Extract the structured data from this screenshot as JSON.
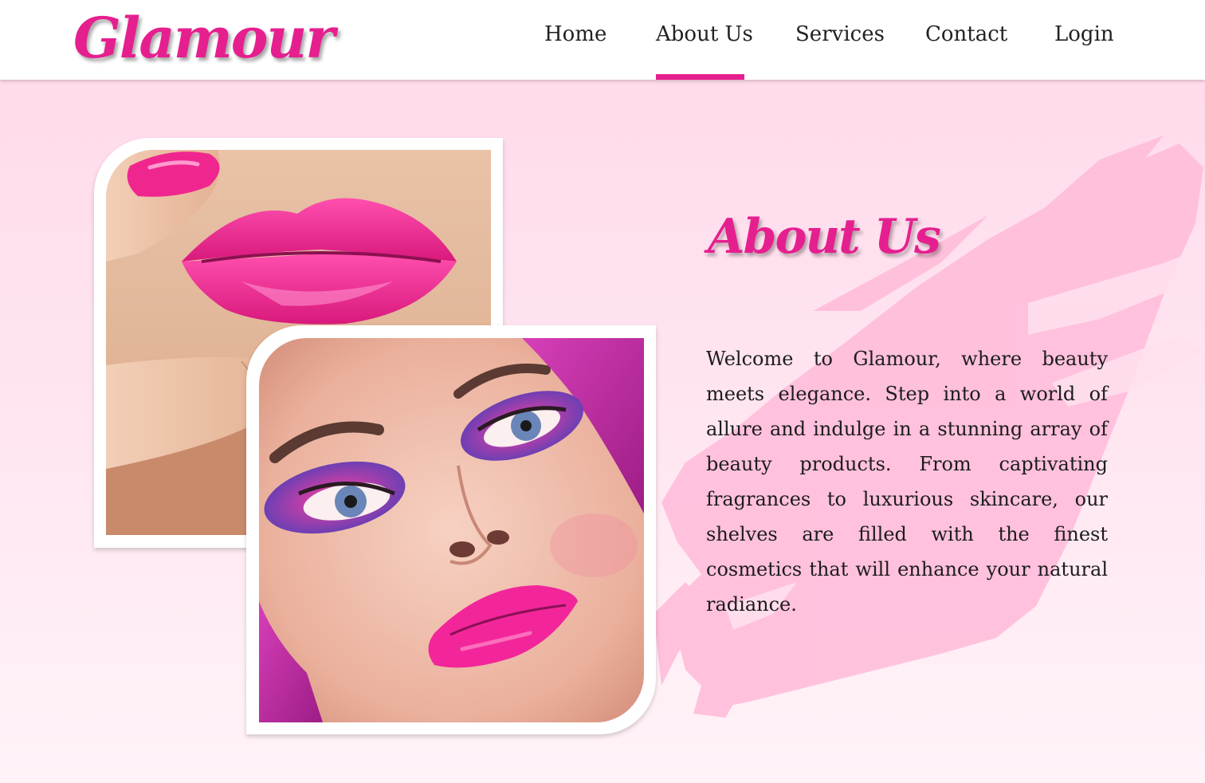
{
  "header": {
    "logo": "Glamour",
    "nav": [
      {
        "label": "Home",
        "active": false
      },
      {
        "label": "About Us",
        "active": true
      },
      {
        "label": "Services",
        "active": false
      },
      {
        "label": "Contact",
        "active": false
      },
      {
        "label": "Login",
        "active": false
      }
    ]
  },
  "about": {
    "title": "About Us",
    "body": "Welcome to Glamour, where beauty meets elegance. Step into a world of allure and indulge in a stunning array of beauty products. From captivating fragrances to luxurious skincare, our shelves are filled with the finest cosmetics that will enhance your natural radiance."
  },
  "images": {
    "lips_photo": "lips-closeup",
    "face_photo": "makeup-model"
  },
  "colors": {
    "accent": "#e61f8f",
    "background": "#ffd8ea",
    "brush": "#ffb8d6"
  }
}
